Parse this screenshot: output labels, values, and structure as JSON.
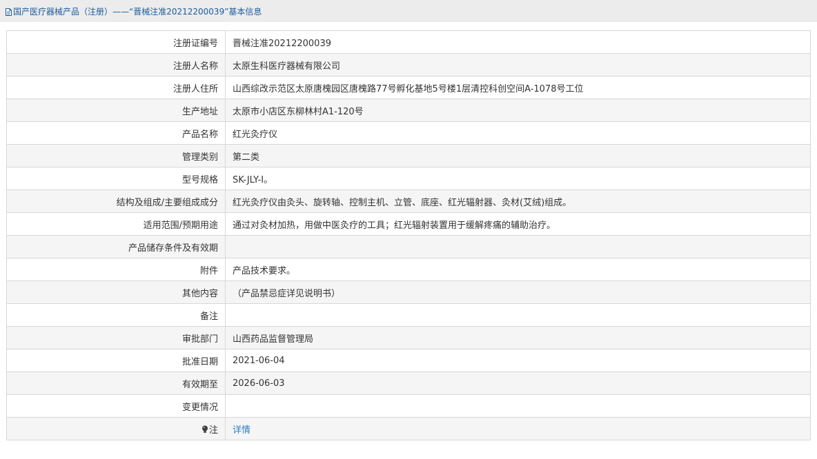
{
  "breadcrumb": {
    "icon": "document-icon",
    "text": "国产医疗器械产品（注册）——“晋械注准20212200039”基本信息"
  },
  "rows": [
    {
      "label": "注册证编号",
      "value": "晋械注准20212200039"
    },
    {
      "label": "注册人名称",
      "value": "太原生科医疗器械有限公司"
    },
    {
      "label": "注册人住所",
      "value": "山西综改示范区太原唐槐园区唐槐路77号孵化基地5号楼1层清控科创空间A-1078号工位"
    },
    {
      "label": "生产地址",
      "value": "太原市小店区东柳林村A1-120号"
    },
    {
      "label": "产品名称",
      "value": "红光灸疗仪"
    },
    {
      "label": "管理类别",
      "value": "第二类"
    },
    {
      "label": "型号规格",
      "value": "SK-JLY-I。"
    },
    {
      "label": "结构及组成/主要组成成分",
      "value": "红光灸疗仪由灸头、旋转轴、控制主机、立管、底座、红光辐射器、灸材(艾绒)组成。"
    },
    {
      "label": "适用范围/预期用途",
      "value": "通过对灸材加热，用做中医灸疗的工具；红光辐射装置用于缓解疼痛的辅助治疗。"
    },
    {
      "label": "产品储存条件及有效期",
      "value": ""
    },
    {
      "label": "附件",
      "value": "产品技术要求。"
    },
    {
      "label": "其他内容",
      "value": "（产品禁忌症详见说明书）"
    },
    {
      "label": "备注",
      "value": ""
    },
    {
      "label": "审批部门",
      "value": "山西药品监督管理局"
    },
    {
      "label": "批准日期",
      "value": "2021-06-04"
    },
    {
      "label": "有效期至",
      "value": "2026-06-03"
    },
    {
      "label": "变更情况",
      "value": ""
    }
  ],
  "note_row": {
    "icon": "lightbulb-icon",
    "label": "注",
    "link_text": "详情"
  },
  "colors": {
    "link": "#2d7dc4",
    "breadcrumb_text": "#1a5b9c",
    "topbar_bg": "#ececec",
    "row_alt_bg": "#f5f5f5",
    "border": "#d7d7d7"
  }
}
